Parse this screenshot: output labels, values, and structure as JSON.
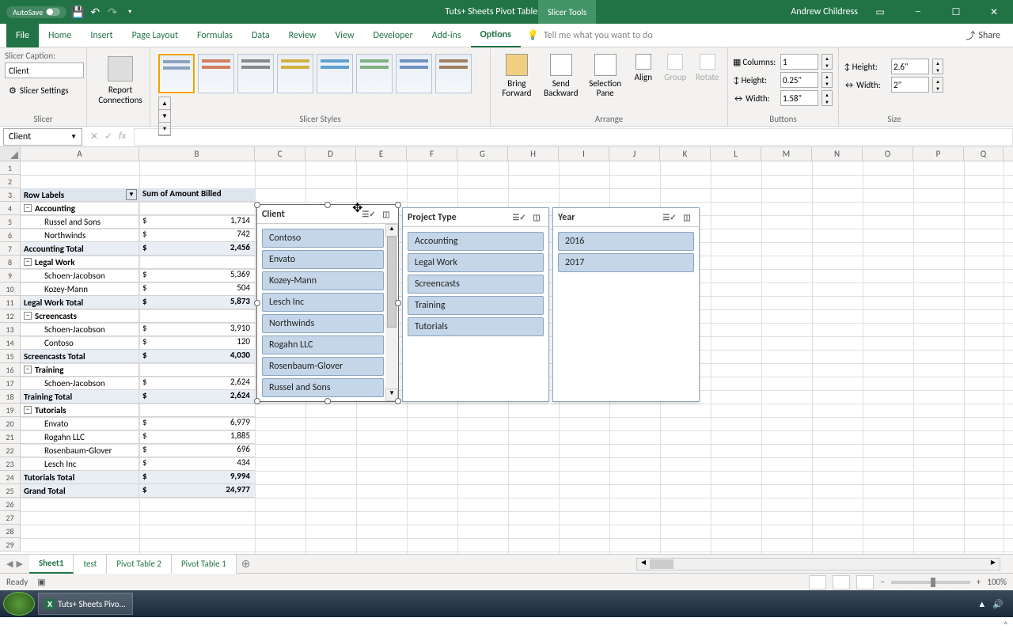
{
  "titlebar": {
    "autosave": "AutoSave",
    "title": "Tuts+ Sheets Pivot Tables - Excel",
    "context": "Slicer Tools",
    "user": "Andrew Childress"
  },
  "tabs": {
    "file": "File",
    "home": "Home",
    "insert": "Insert",
    "layout": "Page Layout",
    "formulas": "Formulas",
    "data": "Data",
    "review": "Review",
    "view": "View",
    "developer": "Developer",
    "addins": "Add-ins",
    "options": "Options",
    "tell": "Tell me what you want to do",
    "share": "Share"
  },
  "ribbon": {
    "slicer": {
      "caption_label": "Slicer Caption:",
      "caption_value": "Client",
      "settings": "Slicer Settings",
      "connections": "Report\nConnections",
      "group": "Slicer"
    },
    "styles_group": "Slicer Styles",
    "arrange": {
      "bring": "Bring\nForward",
      "send": "Send\nBackward",
      "selpane": "Selection\nPane",
      "align": "Align",
      "group": "Group",
      "rotate": "Rotate",
      "label": "Arrange"
    },
    "buttons": {
      "columns": "Columns:",
      "columns_v": "1",
      "height": "Height:",
      "height_v": "0.25\"",
      "width": "Width:",
      "width_v": "1.58\"",
      "label": "Buttons"
    },
    "size": {
      "height": "Height:",
      "height_v": "2.6\"",
      "width": "Width:",
      "width_v": "2\"",
      "label": "Size"
    }
  },
  "namebox": "Client",
  "columns": [
    "A",
    "B",
    "C",
    "D",
    "E",
    "F",
    "G",
    "H",
    "I",
    "J",
    "K",
    "L",
    "M",
    "N",
    "O",
    "P",
    "Q"
  ],
  "pivot": {
    "hdr1": "Row Labels",
    "hdr2": "Sum of Amount Billed",
    "rows": [
      {
        "t": "grp",
        "l": "Accounting"
      },
      {
        "t": "d",
        "l": "Russel and Sons",
        "c": "$",
        "v": "1,714"
      },
      {
        "t": "d",
        "l": "Northwinds",
        "c": "$",
        "v": "742"
      },
      {
        "t": "tot",
        "l": "Accounting Total",
        "c": "$",
        "v": "2,456"
      },
      {
        "t": "grp",
        "l": "Legal Work"
      },
      {
        "t": "d",
        "l": "Schoen-Jacobson",
        "c": "$",
        "v": "5,369"
      },
      {
        "t": "d",
        "l": "Kozey-Mann",
        "c": "$",
        "v": "504"
      },
      {
        "t": "tot",
        "l": "Legal Work Total",
        "c": "$",
        "v": "5,873"
      },
      {
        "t": "grp",
        "l": "Screencasts"
      },
      {
        "t": "d",
        "l": "Schoen-Jacobson",
        "c": "$",
        "v": "3,910"
      },
      {
        "t": "d",
        "l": "Contoso",
        "c": "$",
        "v": "120"
      },
      {
        "t": "tot",
        "l": "Screencasts Total",
        "c": "$",
        "v": "4,030"
      },
      {
        "t": "grp",
        "l": "Training"
      },
      {
        "t": "d",
        "l": "Schoen-Jacobson",
        "c": "$",
        "v": "2,624"
      },
      {
        "t": "tot",
        "l": "Training Total",
        "c": "$",
        "v": "2,624"
      },
      {
        "t": "grp",
        "l": "Tutorials"
      },
      {
        "t": "d",
        "l": "Envato",
        "c": "$",
        "v": "6,979"
      },
      {
        "t": "d",
        "l": "Rogahn LLC",
        "c": "$",
        "v": "1,885"
      },
      {
        "t": "d",
        "l": "Rosenbaum-Glover",
        "c": "$",
        "v": "696"
      },
      {
        "t": "d",
        "l": "Lesch Inc",
        "c": "$",
        "v": "434"
      },
      {
        "t": "tot",
        "l": "Tutorials Total",
        "c": "$",
        "v": "9,994"
      },
      {
        "t": "gt",
        "l": "Grand Total",
        "c": "$",
        "v": "24,977"
      }
    ]
  },
  "slicers": {
    "client": {
      "title": "Client",
      "items": [
        "Contoso",
        "Envato",
        "Kozey-Mann",
        "Lesch Inc",
        "Northwinds",
        "Rogahn LLC",
        "Rosenbaum-Glover",
        "Russel and Sons"
      ]
    },
    "project": {
      "title": "Project Type",
      "items": [
        "Accounting",
        "Legal Work",
        "Screencasts",
        "Training",
        "Tutorials"
      ]
    },
    "year": {
      "title": "Year",
      "items": [
        "2016",
        "2017"
      ]
    }
  },
  "sheets": {
    "s1": "Sheet1",
    "s2": "test",
    "s3": "Pivot Table 2",
    "s4": "Pivot Table 1"
  },
  "status": {
    "ready": "Ready",
    "zoom": "100%"
  },
  "task": {
    "app": "Tuts+ Sheets Pivo..."
  }
}
